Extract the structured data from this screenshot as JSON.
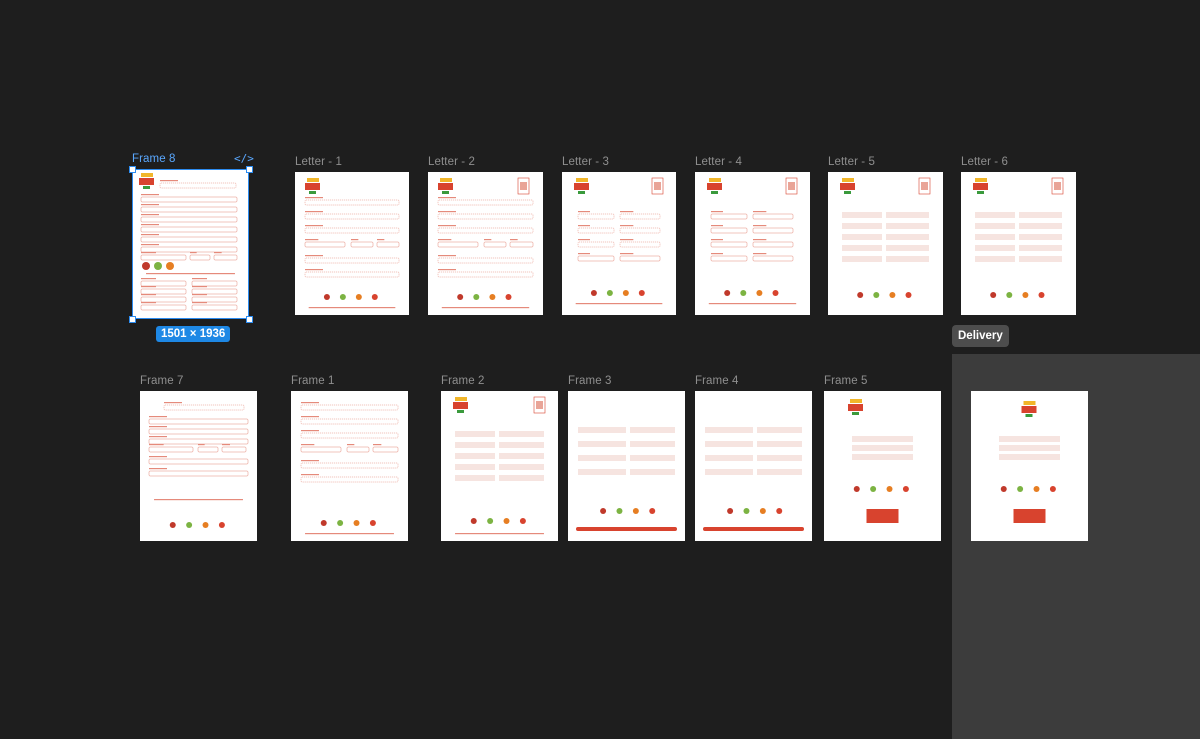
{
  "selection": {
    "frame_name": "Frame 8",
    "size_badge": "1501 × 1936",
    "code_icon": "</>"
  },
  "section": {
    "label": "Delivery"
  },
  "row1": [
    {
      "label": "Frame 8",
      "variant": "form-dense"
    },
    {
      "label": "Letter - 1",
      "variant": "form-logo-left"
    },
    {
      "label": "Letter - 2",
      "variant": "form-logo-qr"
    },
    {
      "label": "Letter - 3",
      "variant": "form-short"
    },
    {
      "label": "Letter - 4",
      "variant": "form-grid"
    },
    {
      "label": "Letter - 5",
      "variant": "form-shaded"
    },
    {
      "label": "Letter - 6",
      "variant": "form-shaded-2"
    }
  ],
  "row2": [
    {
      "label": "Frame 7",
      "variant": "form-nologo"
    },
    {
      "label": "Frame 1",
      "variant": "form-simple"
    },
    {
      "label": "Frame 2",
      "variant": "form-shaded"
    },
    {
      "label": "Frame 3",
      "variant": "form-bar"
    },
    {
      "label": "Frame 4",
      "variant": "form-bar"
    },
    {
      "label": "Frame 5",
      "variant": "summary-box"
    },
    {
      "label": "",
      "variant": "summary-box-2"
    }
  ],
  "colors": {
    "canvas": "#1e1e1e",
    "section": "#3c3c3c",
    "selection": "#2d8cf0",
    "brand": "#d8432e"
  }
}
